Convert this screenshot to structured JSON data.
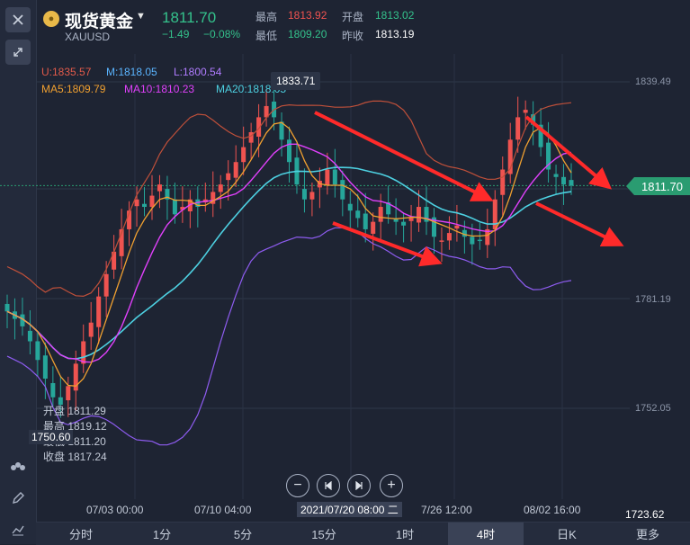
{
  "header": {
    "symbol_name": "现货黄金",
    "symbol_code": "XAUUSD",
    "price": "1811.70",
    "change": "−1.49",
    "change_pct": "−0.08%",
    "high_label": "最高",
    "high_value": "1813.92",
    "open_label": "开盘",
    "open_value": "1813.02",
    "low_label": "最低",
    "low_value": "1809.20",
    "prev_close_label": "昨收",
    "prev_close_value": "1813.19"
  },
  "indicators": {
    "boll_u": "U:1835.57",
    "boll_m": "M:1818.05",
    "boll_l": "L:1800.54",
    "ma5": "MA5:1809.79",
    "ma10": "MA10:1810.23",
    "ma20": "MA20:1818.05"
  },
  "price_axis": [
    "1839.49",
    "1781.19",
    "1752.05",
    "1723.62"
  ],
  "current_price_tag": "1811.70",
  "max_tag": "1833.71",
  "low_tag": "1750.60",
  "ohlc_tooltip": {
    "open": "开盘 1811.29",
    "high": "最高 1819.12",
    "low": "最低 1811.20",
    "close": "收盘 1817.24"
  },
  "date_axis": [
    "07/03 00:00",
    "07/10 04:00",
    "7/26 12:00",
    "08/02 16:00"
  ],
  "cursor_date": "2021/07/20 08:00 二",
  "timeframes": [
    "分时",
    "1分",
    "5分",
    "15分",
    "1时",
    "4时",
    "日K",
    "更多"
  ],
  "active_timeframe": "4时",
  "colors": {
    "up": "#ef5350",
    "down": "#26a69a",
    "ma5": "#f0a030",
    "ma10": "#e040fb",
    "ma20": "#4dd0e1",
    "boll_u": "#c0503a",
    "boll_l": "#8e5cf0",
    "arrow": "#ff2a2a",
    "accent": "#2a9c71"
  },
  "chart_data": {
    "type": "candlestick",
    "symbol": "XAUUSD",
    "interval": "4H",
    "ylim": [
      1723.62,
      1845
    ],
    "y_ticks": [
      1839.49,
      1781.19,
      1752.05
    ],
    "x_ticks": [
      "07/03 00:00",
      "07/10 04:00",
      "7/26 12:00",
      "08/02 16:00"
    ],
    "close_series": [
      1778,
      1776,
      1774,
      1770,
      1765,
      1760,
      1755,
      1753,
      1758,
      1764,
      1770,
      1775,
      1782,
      1788,
      1794,
      1800,
      1805,
      1808,
      1806,
      1809,
      1812,
      1808,
      1804,
      1806,
      1808,
      1806,
      1808,
      1810,
      1812,
      1815,
      1818,
      1822,
      1826,
      1830,
      1833,
      1830,
      1824,
      1818,
      1812,
      1808,
      1810,
      1813,
      1816,
      1812,
      1808,
      1805,
      1803,
      1800,
      1802,
      1806,
      1804,
      1802,
      1801,
      1803,
      1806,
      1802,
      1798,
      1797,
      1799,
      1801,
      1798,
      1796,
      1797,
      1800,
      1808,
      1816,
      1824,
      1830,
      1832,
      1828,
      1822,
      1816,
      1814,
      1812,
      1811.7
    ],
    "last_close": 1811.7,
    "series": [
      {
        "name": "MA5",
        "last": 1809.79
      },
      {
        "name": "MA10",
        "last": 1810.23
      },
      {
        "name": "MA20",
        "last": 1818.05
      },
      {
        "name": "BOLL U",
        "last": 1835.57
      },
      {
        "name": "BOLL M",
        "last": 1818.05
      },
      {
        "name": "BOLL L",
        "last": 1800.54
      }
    ],
    "grid": true
  }
}
